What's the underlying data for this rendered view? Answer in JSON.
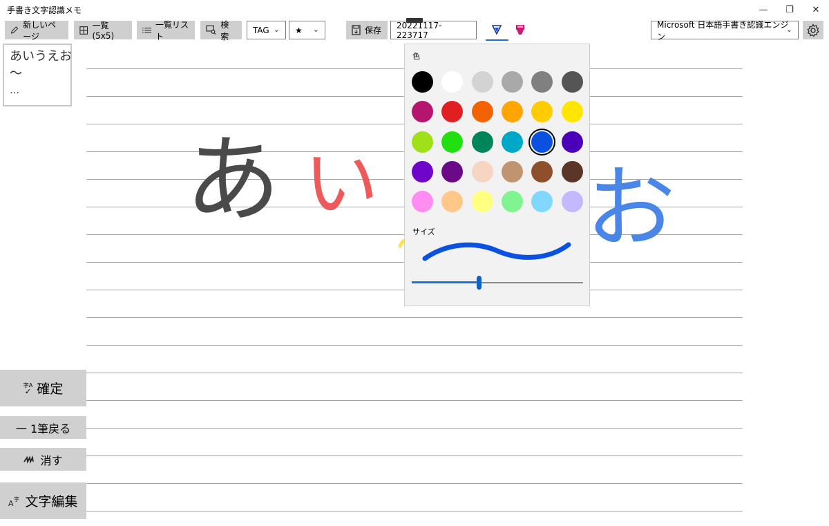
{
  "window": {
    "title": "手書き文字認識メモ",
    "min_glyph": "—",
    "max_glyph": "❐",
    "close_glyph": "✕"
  },
  "toolbar": {
    "new_page": "新しいページ",
    "grid_view": "一覧(5x5)",
    "list_view": "一覧リスト",
    "search": "検索",
    "tag_value": "TAG",
    "star_value": "★",
    "save": "保存",
    "filename": "20221117-223717",
    "engine_value": "Microsoft 日本語手書き認識エンジン"
  },
  "memo_preview": {
    "lines": [
      "あいうえお",
      "〜",
      "…"
    ]
  },
  "side_buttons": {
    "confirm": "確定",
    "confirm_icon_text": "字A",
    "undo": "一 1筆戻る",
    "erase": "消す",
    "edit_text": "文字編集"
  },
  "ink": {
    "char_a": "あ",
    "char_i": "い",
    "char_o": "お"
  },
  "pen_popup": {
    "color_label": "色",
    "size_label": "サイズ",
    "colors": [
      "#000000",
      "#ffffff",
      "#d3d3d3",
      "#a9a9a9",
      "#808080",
      "#555555",
      "#b5156e",
      "#e02020",
      "#f36200",
      "#ffa500",
      "#ffcc00",
      "#ffe600",
      "#a0e019",
      "#22e010",
      "#00845a",
      "#00a8c8",
      "#0a51e0",
      "#4b00b8",
      "#6f05c8",
      "#6a0a88",
      "#f6d6c2",
      "#c09470",
      "#8e4f2a",
      "#5a3528",
      "#ff8cf0",
      "#ffc888",
      "#ffff80",
      "#80f490",
      "#80d8ff",
      "#c4b8ff"
    ],
    "selected_color": "#0a51e0",
    "size_value": 0.39
  },
  "colors": {
    "toolbar_button": "#cfcfcf",
    "rule_line": "#7cc07c",
    "ink_black": "#4a4a4a",
    "ink_red": "#ee5a5a",
    "ink_blue": "#4a86e8"
  }
}
